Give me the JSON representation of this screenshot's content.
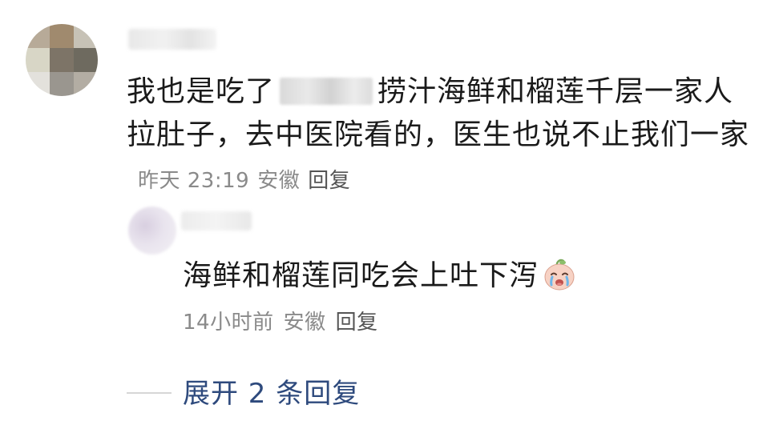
{
  "main_comment": {
    "text_before": "我也是吃了",
    "text_after": "捞汁海鲜和榴莲千层一家人拉肚子，去中医院看的，医生也说不止我们一家",
    "time": "昨天 23:19",
    "location": "安徽",
    "reply_label": "回复"
  },
  "reply": {
    "text": "海鲜和榴莲同吃会上吐下泻",
    "emoji": "crying-face-emoji",
    "time": "14小时前",
    "location": "安徽",
    "reply_label": "回复"
  },
  "expand": {
    "label": "展开 2 条回复"
  },
  "colors": {
    "text": "#1a1a1a",
    "meta": "#8a8a8a",
    "link": "#2e4a7d"
  }
}
